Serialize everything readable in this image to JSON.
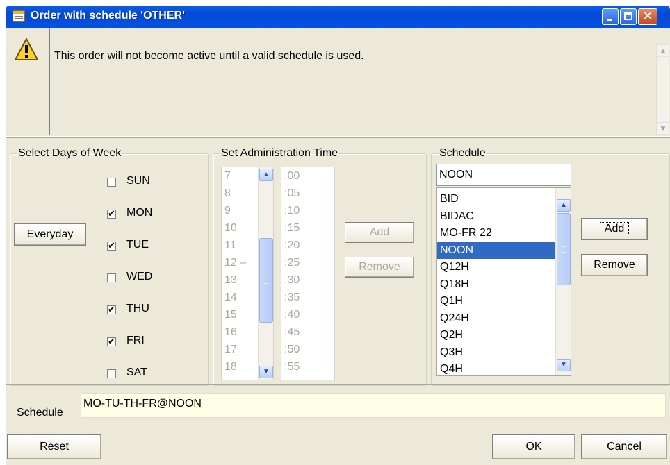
{
  "window": {
    "title": "Order with schedule 'OTHER'",
    "controls": {
      "minimize": "minimize",
      "maximize": "maximize",
      "close": "✕"
    }
  },
  "message": {
    "text": "This order will not become active until a valid schedule is used."
  },
  "days": {
    "legend": "Select Days of Week",
    "everyday_label": "Everyday",
    "items": [
      {
        "label": "SUN",
        "checked": false,
        "mark": ""
      },
      {
        "label": "MON",
        "checked": true,
        "mark": "✔"
      },
      {
        "label": "TUE",
        "checked": true,
        "mark": "✔"
      },
      {
        "label": "WED",
        "checked": false,
        "mark": ""
      },
      {
        "label": "THU",
        "checked": true,
        "mark": "✔"
      },
      {
        "label": "FRI",
        "checked": true,
        "mark": "✔"
      },
      {
        "label": "SAT",
        "checked": false,
        "mark": ""
      }
    ]
  },
  "admin_time": {
    "legend": "Set Administration Time",
    "hours": [
      "7",
      "8",
      "9",
      "10",
      "11",
      "12 –",
      "13",
      "14",
      "15",
      "16",
      "17",
      "18"
    ],
    "minutes": [
      ":00",
      ":05",
      ":10",
      ":15",
      ":20",
      ":25",
      ":30",
      ":35",
      ":40",
      ":45",
      ":50",
      ":55"
    ],
    "add_label": "Add",
    "remove_label": "Remove"
  },
  "schedule": {
    "legend": "Schedule",
    "input_value": "NOON",
    "list": [
      "BID",
      "BIDAC",
      "MO-FR 22",
      "NOON",
      "Q12H",
      "Q18H",
      "Q1H",
      "Q24H",
      "Q2H",
      "Q3H",
      "Q4H"
    ],
    "selected": "NOON",
    "add_label": "Add",
    "remove_label": "Remove"
  },
  "bottom": {
    "schedule_label": "Schedule",
    "schedule_value": "MO-TU-TH-FR@NOON",
    "reset_label": "Reset",
    "ok_label": "OK",
    "cancel_label": "Cancel"
  }
}
